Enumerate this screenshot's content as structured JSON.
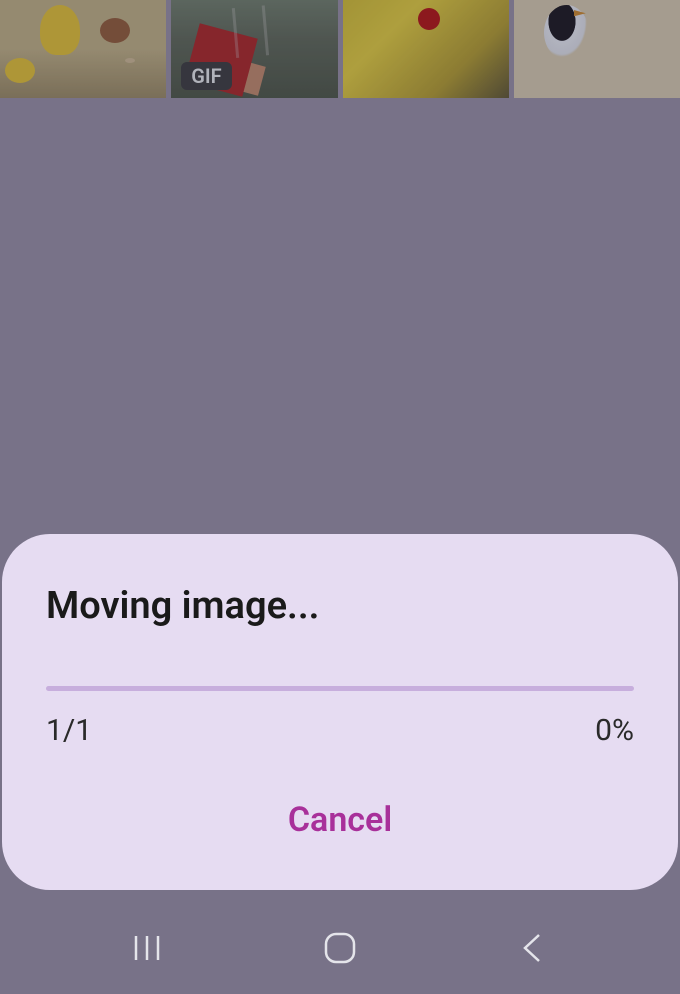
{
  "gallery": {
    "thumbnails": [
      {
        "name": "thumb-dog-cartoon",
        "gif": false
      },
      {
        "name": "thumb-road-gif",
        "gif": true,
        "badge": "GIF"
      },
      {
        "name": "thumb-pikachu",
        "gif": false
      },
      {
        "name": "thumb-bird-drawing",
        "gif": false
      }
    ]
  },
  "dialog": {
    "title": "Moving image...",
    "progress_count": "1/1",
    "progress_percent": "0%",
    "cancel_label": "Cancel",
    "progress_value": 0
  },
  "nav": {
    "recents": "recents",
    "home": "home",
    "back": "back"
  }
}
